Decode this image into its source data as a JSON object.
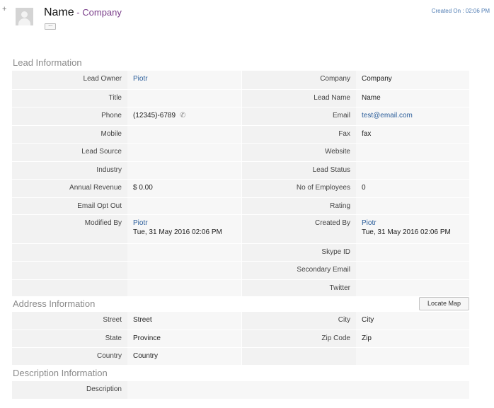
{
  "header": {
    "name": "Name",
    "separator": " - ",
    "company": "Company",
    "more_label": "....",
    "created_on": "Created On : 02:06 PM"
  },
  "lead_info": {
    "title": "Lead Information",
    "lead_owner": {
      "label": "Lead Owner",
      "value": "Piotr"
    },
    "company": {
      "label": "Company",
      "value": "Company"
    },
    "title_field": {
      "label": "Title",
      "value": ""
    },
    "lead_name": {
      "label": "Lead Name",
      "value": "Name"
    },
    "phone": {
      "label": "Phone",
      "value": "(12345)-6789"
    },
    "email": {
      "label": "Email",
      "value": "test@email.com"
    },
    "mobile": {
      "label": "Mobile",
      "value": ""
    },
    "fax": {
      "label": "Fax",
      "value": "fax"
    },
    "lead_source": {
      "label": "Lead Source",
      "value": ""
    },
    "website": {
      "label": "Website",
      "value": ""
    },
    "industry": {
      "label": "Industry",
      "value": ""
    },
    "lead_status": {
      "label": "Lead Status",
      "value": ""
    },
    "annual_revenue": {
      "label": "Annual Revenue",
      "value": "$ 0.00"
    },
    "no_of_employees": {
      "label": "No of Employees",
      "value": "0"
    },
    "email_opt_out": {
      "label": "Email Opt Out",
      "value": ""
    },
    "rating": {
      "label": "Rating",
      "value": ""
    },
    "modified_by": {
      "label": "Modified By",
      "user": "Piotr",
      "date": "Tue, 31 May 2016 02:06 PM"
    },
    "created_by": {
      "label": "Created By",
      "user": "Piotr",
      "date": "Tue, 31 May 2016 02:06 PM"
    },
    "skype_id": {
      "label": "Skype ID",
      "value": ""
    },
    "secondary_email": {
      "label": "Secondary Email",
      "value": ""
    },
    "twitter": {
      "label": "Twitter",
      "value": ""
    }
  },
  "address_info": {
    "title": "Address Information",
    "locate_map_label": "Locate Map",
    "street": {
      "label": "Street",
      "value": "Street"
    },
    "city": {
      "label": "City",
      "value": "City"
    },
    "state": {
      "label": "State",
      "value": "Province"
    },
    "zip_code": {
      "label": "Zip Code",
      "value": "Zip"
    },
    "country": {
      "label": "Country",
      "value": "Country"
    }
  },
  "description_info": {
    "title": "Description Information",
    "description": {
      "label": "Description",
      "value": ""
    }
  },
  "icons": {
    "plus": "+",
    "phone": "✆"
  },
  "colors": {
    "link": "#2a5d9a",
    "company_accent": "#7a3e8a",
    "section_title": "#8a8a8a",
    "label_bg": "#f2f2f2",
    "value_bg": "#f7f7f7"
  }
}
